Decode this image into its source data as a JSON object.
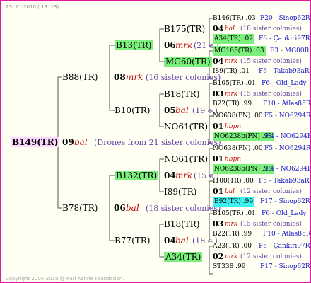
{
  "date": "23- 11-2010 ( 19: 13)",
  "root": {
    "label": "B149(TR)",
    "gen": "09",
    "sire": "bal",
    "note": "(Drones from 21 sister colonies)"
  },
  "g1": {
    "top": {
      "label": "B88(TR)",
      "gen": "08",
      "sire": "mrk",
      "note": "(16 sister colonies)"
    },
    "bot": {
      "label": "B78(TR)",
      "gen": "06",
      "sire": "bal",
      "note": "(18 sister colonies)"
    }
  },
  "g2": [
    {
      "label": "B13(TR)",
      "gen": "06",
      "sire": "mrk",
      "note": "(21 c.)"
    },
    {
      "label": "B10(TR)",
      "gen": "05",
      "sire": "bal",
      "note": "(19 c.)"
    },
    {
      "label": "B132(TR)",
      "gen": "04",
      "sire": "mrk",
      "note": "(15 c.)"
    },
    {
      "label": "B77(TR)",
      "gen": "04",
      "sire": "bal",
      "note": "(18 c.)"
    }
  ],
  "g3": [
    {
      "label": "B175(TR)"
    },
    {
      "label": "MG60(TR)"
    },
    {
      "label": "B18(TR)"
    },
    {
      "label": "NO61(TR)"
    },
    {
      "label": "NO61(TR)"
    },
    {
      "label": "I89(TR)"
    },
    {
      "label": "B18(TR)"
    },
    {
      "label": "A34(TR)"
    }
  ],
  "g4": [
    {
      "a": "B146(TR) .03",
      "ar": "F20 - Sinop62R",
      "gen": "04",
      "sire": "bal",
      "note": "(18 sister colonies)",
      "b": "A34(TR) .02",
      "br": "F6 - Çankiri97R"
    },
    {
      "a": "MG165(TR) .03",
      "ar": "F3 - MG00R",
      "gen": "04",
      "sire": "mrk",
      "note": "(15 sister colonies)",
      "b": "I89(TR) .01",
      "br": "F6 - Takab93aR"
    },
    {
      "a": "B105(TR) .01",
      "ar": "F6 - Old_Lady",
      "gen": "03",
      "sire": "mrk",
      "note": "(15 sister colonies)",
      "b": "B22(TR) .99",
      "br": "F10 - Atlas85R"
    },
    {
      "a": "NO638(PN) .00",
      "ar": "F5 - NO6294R",
      "gen": "01",
      "sire": "hbpn",
      "note": "",
      "b": "NO6238b(PN) .98",
      "br": "F4 - NO6294R"
    },
    {
      "a": "NO638(PN) .00",
      "ar": "F5 - NO6294R",
      "gen": "01",
      "sire": "hbpn",
      "note": "",
      "b": "NO6238b(PN) .98",
      "br": "F4 - NO6294R"
    },
    {
      "a": "I100(TR) .00",
      "ar": "F5 - Takab93aR",
      "gen": "01",
      "sire": "bal",
      "note": "(12 sister colonies)",
      "b": "B92(TR) .99",
      "br": "F17 - Sinop62R"
    },
    {
      "a": "B105(TR) .01",
      "ar": "F6 - Old_Lady",
      "gen": "03",
      "sire": "mrk",
      "note": "(15 sister colonies)",
      "b": "B22(TR) .99",
      "br": "F10 - Atlas85R"
    },
    {
      "a": "A23(TR) .00",
      "ar": "F5 - Çankiri97R",
      "gen": "02",
      "sire": "mrk",
      "note": "(12 sister colonies)",
      "b": "ST338 .99",
      "br": "F17 - Sinop62R"
    }
  ],
  "footer": "Copyright 2004-2010 @ Karl Kehrle Foundation.",
  "colors": {
    "frame": "#e01aa0",
    "green": "#7cf07c",
    "cyan": "#3ff0f0",
    "lines": "#555555",
    "sire": "#c01010",
    "ref": "#1a1acc"
  }
}
